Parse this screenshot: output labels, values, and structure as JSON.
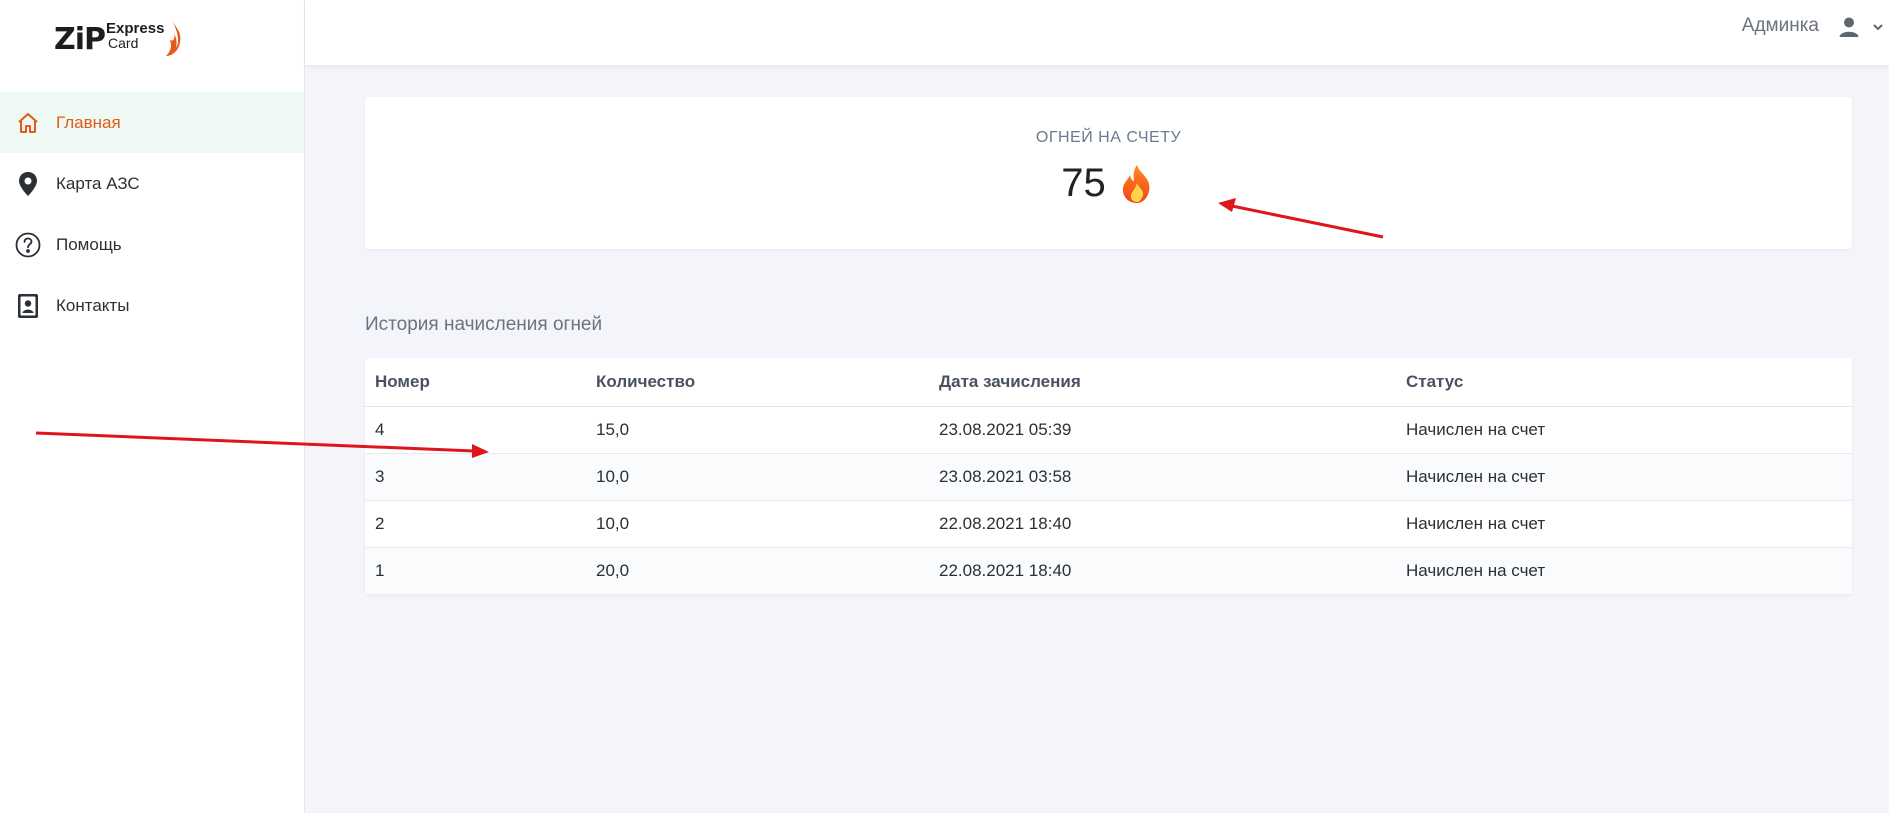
{
  "brand": {
    "logo_main": "ZiP",
    "logo_line1": "Express",
    "logo_line2": "Card",
    "accent": "#e35a1b",
    "active_bg": "#eef9f3"
  },
  "sidebar": {
    "items": [
      {
        "label": "Главная",
        "icon": "home-icon",
        "active": true
      },
      {
        "label": "Карта АЗС",
        "icon": "map-pin-icon",
        "active": false
      },
      {
        "label": "Помощь",
        "icon": "help-circle-icon",
        "active": false
      },
      {
        "label": "Контакты",
        "icon": "contact-card-icon",
        "active": false
      }
    ]
  },
  "header": {
    "user_name": "Админка",
    "user_icon": "user-icon",
    "menu_icon": "chevron-down-icon"
  },
  "balance": {
    "title": "ОГНЕЙ НА СЧЕТУ",
    "value": "75",
    "icon": "fire-icon"
  },
  "history": {
    "title": "История начисления огней",
    "columns": [
      "Номер",
      "Количество",
      "Дата зачисления",
      "Статус"
    ],
    "rows": [
      [
        "4",
        "15,0",
        "23.08.2021 05:39",
        "Начислен на счет"
      ],
      [
        "3",
        "10,0",
        "23.08.2021 03:58",
        "Начислен на счет"
      ],
      [
        "2",
        "10,0",
        "22.08.2021 18:40",
        "Начислен на счет"
      ],
      [
        "1",
        "20,0",
        "22.08.2021 18:40",
        "Начислен на счет"
      ]
    ]
  },
  "annotations": {
    "arrow_color": "#e0141c"
  }
}
